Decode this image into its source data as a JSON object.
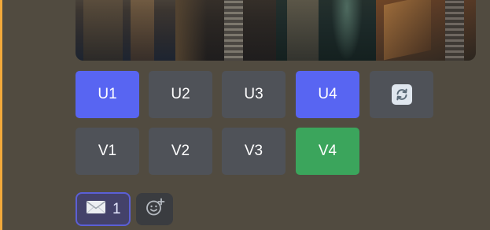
{
  "buttons": {
    "upscale": [
      {
        "label": "U1",
        "style": "primary"
      },
      {
        "label": "U2",
        "style": "secondary"
      },
      {
        "label": "U3",
        "style": "secondary"
      },
      {
        "label": "U4",
        "style": "primary"
      }
    ],
    "variation": [
      {
        "label": "V1",
        "style": "secondary"
      },
      {
        "label": "V2",
        "style": "secondary"
      },
      {
        "label": "V3",
        "style": "secondary"
      },
      {
        "label": "V4",
        "style": "success"
      }
    ],
    "reroll": {
      "icon": "reroll-icon"
    }
  },
  "reactions": [
    {
      "emoji": "envelope-icon",
      "count": "1",
      "selected": true
    }
  ],
  "add_reaction": {
    "icon": "add-reaction-icon"
  },
  "colors": {
    "background": "#514b40",
    "button_secondary": "#4f5258",
    "button_primary": "#5865f2",
    "button_success": "#3ba55c",
    "reaction_border": "#5b5fd6",
    "accent_strip": "#f2a93b"
  }
}
